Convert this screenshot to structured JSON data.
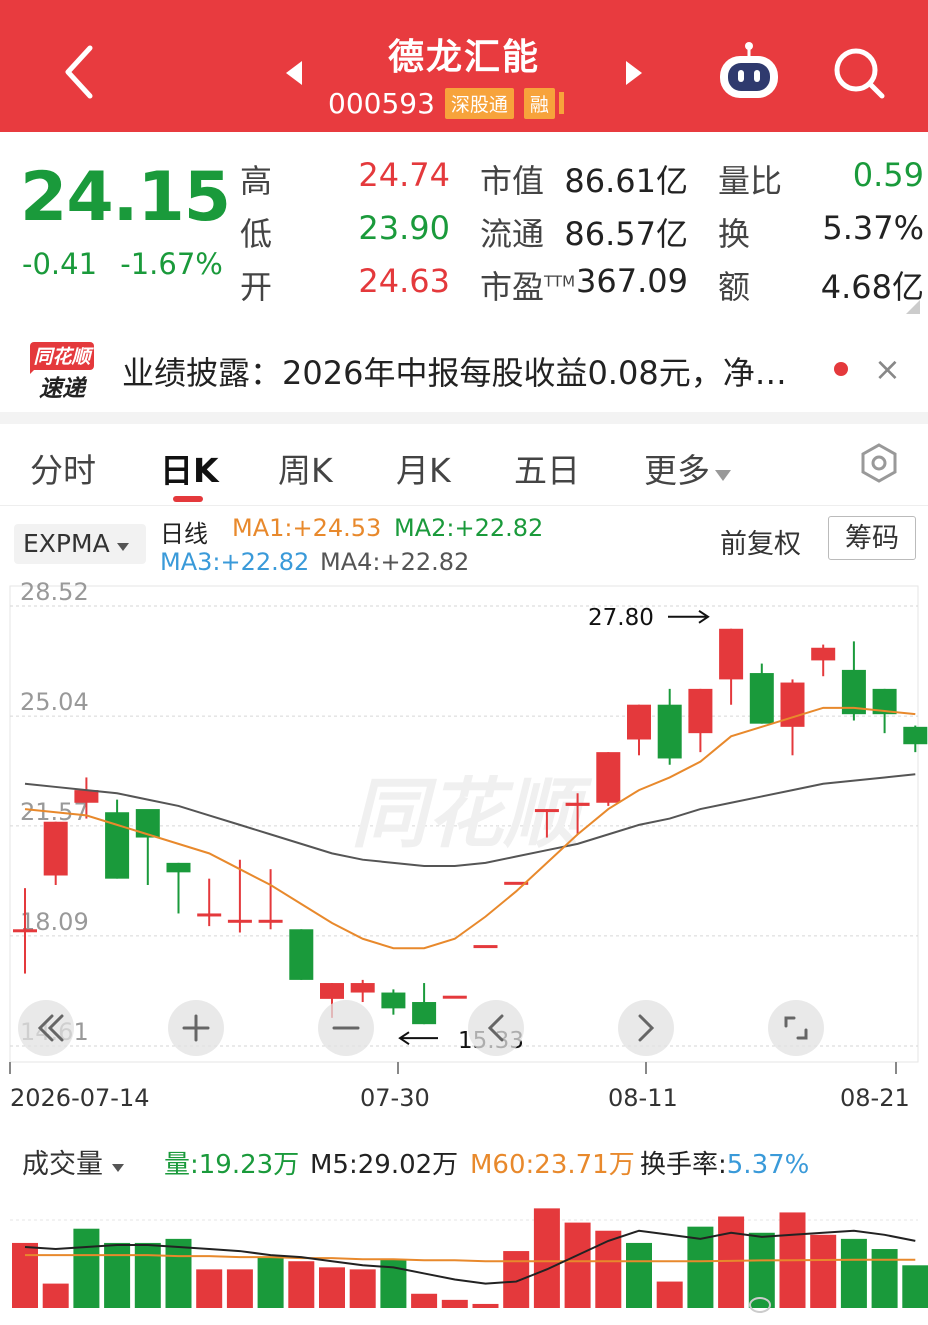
{
  "header": {
    "name": "德龙汇能",
    "code": "000593",
    "tags": [
      "深股通",
      "融"
    ],
    "icons": [
      "back-arrow-icon",
      "prev-triangle-icon",
      "next-triangle-icon",
      "robot-assistant-icon",
      "search-icon"
    ]
  },
  "quote": {
    "price": "24.15",
    "change": "-0.41",
    "change_pct": "-1.67%",
    "high_label": "高",
    "high": "24.74",
    "low_label": "低",
    "low": "23.90",
    "open_label": "开",
    "open": "24.63",
    "mktcap_label": "市值",
    "mktcap": "86.61亿",
    "float_label": "流通",
    "float": "86.57亿",
    "pe_label": "市盈",
    "pe_sup": "TTM",
    "pe": "367.09",
    "volratio_label": "量比",
    "volratio": "0.59",
    "turnover_label": "换",
    "turnover": "5.37%",
    "amount_label": "额",
    "amount": "4.68亿"
  },
  "news": {
    "logo_line1": "同花顺",
    "logo_line2": "速递",
    "text": "业绩披露：2026年中报每股收益0.08元，净…",
    "close": "×"
  },
  "tabs": [
    {
      "label": "分时"
    },
    {
      "label": "日K",
      "active": true
    },
    {
      "label": "周K"
    },
    {
      "label": "月K"
    },
    {
      "label": "五日"
    },
    {
      "label": "更多"
    }
  ],
  "indicators": {
    "select": "EXPMA",
    "period": "日线",
    "ma1": "MA1:+24.53",
    "ma2": "MA2:+22.82",
    "ma3": "MA3:+22.82",
    "ma4": "MA4:+22.82",
    "fq": "前复权",
    "chips": "筹码"
  },
  "colors": {
    "up": "#e4393c",
    "down": "#1a9a3b",
    "header": "#e83b3f",
    "ma_orange": "#e8892c",
    "ma_gray": "#555555",
    "ma_blue": "#3a9ad9"
  },
  "chart_data": [
    {
      "type": "candlestick",
      "y_ticks": [
        "28.52",
        "25.04",
        "21.57",
        "18.09",
        "14.61"
      ],
      "ylim": [
        14.61,
        28.52
      ],
      "x_labels": [
        "2026-07-14",
        "07-30",
        "08-11",
        "08-21"
      ],
      "annotations": {
        "max": "27.80",
        "min": "15.33"
      },
      "candles": [
        {
          "o": 18.3,
          "c": 18.3,
          "h": 19.6,
          "l": 16.9
        },
        {
          "o": 20.0,
          "c": 21.7,
          "h": 21.7,
          "l": 19.7
        },
        {
          "o": 22.3,
          "c": 22.7,
          "h": 23.1,
          "l": 21.8
        },
        {
          "o": 22.0,
          "c": 19.9,
          "h": 22.4,
          "l": 19.9
        },
        {
          "o": 22.1,
          "c": 21.2,
          "h": 21.9,
          "l": 19.7
        },
        {
          "o": 20.4,
          "c": 20.1,
          "h": 20.4,
          "l": 18.8
        },
        {
          "o": 18.8,
          "c": 18.8,
          "h": 19.9,
          "l": 18.4
        },
        {
          "o": 18.6,
          "c": 18.6,
          "h": 20.5,
          "l": 18.2
        },
        {
          "o": 18.6,
          "c": 18.6,
          "h": 20.2,
          "l": 18.3
        },
        {
          "o": 18.3,
          "c": 16.7,
          "h": 18.3,
          "l": 16.7
        },
        {
          "o": 16.1,
          "c": 16.6,
          "h": 16.6,
          "l": 15.5
        },
        {
          "o": 16.3,
          "c": 16.6,
          "h": 16.7,
          "l": 16.0
        },
        {
          "o": 16.3,
          "c": 15.8,
          "h": 16.4,
          "l": 15.6
        },
        {
          "o": 16.0,
          "c": 15.3,
          "h": 16.6,
          "l": 15.3
        },
        {
          "o": 16.2,
          "c": 16.2,
          "h": 16.2,
          "l": 16.2
        },
        {
          "o": 17.8,
          "c": 17.8,
          "h": 17.8,
          "l": 17.8
        },
        {
          "o": 19.8,
          "c": 19.8,
          "h": 19.8,
          "l": 19.8
        },
        {
          "o": 22.1,
          "c": 22.1,
          "h": 22.1,
          "l": 21.2
        },
        {
          "o": 22.2,
          "c": 22.3,
          "h": 22.6,
          "l": 21.3
        },
        {
          "o": 22.3,
          "c": 23.9,
          "h": 23.9,
          "l": 22.2
        },
        {
          "o": 24.3,
          "c": 25.4,
          "h": 25.4,
          "l": 23.8
        },
        {
          "o": 25.4,
          "c": 23.7,
          "h": 25.9,
          "l": 23.5
        },
        {
          "o": 24.5,
          "c": 25.9,
          "h": 25.9,
          "l": 23.9
        },
        {
          "o": 26.2,
          "c": 27.8,
          "h": 27.8,
          "l": 25.4
        },
        {
          "o": 26.4,
          "c": 24.8,
          "h": 26.7,
          "l": 24.8
        },
        {
          "o": 24.7,
          "c": 26.1,
          "h": 26.2,
          "l": 23.8
        },
        {
          "o": 26.8,
          "c": 27.2,
          "h": 27.3,
          "l": 26.3
        },
        {
          "o": 26.5,
          "c": 25.1,
          "h": 27.4,
          "l": 24.9
        },
        {
          "o": 25.9,
          "c": 25.1,
          "h": 25.9,
          "l": 24.5
        },
        {
          "o": 24.7,
          "c": 24.15,
          "h": 24.74,
          "l": 23.9
        }
      ],
      "ma_orange": [
        22.1,
        22.0,
        21.9,
        21.6,
        21.3,
        21.0,
        20.7,
        20.2,
        19.7,
        19.1,
        18.5,
        18.0,
        17.7,
        17.7,
        18.0,
        18.7,
        19.5,
        20.4,
        21.3,
        22.1,
        22.7,
        23.1,
        23.6,
        24.4,
        24.7,
        25.0,
        25.3,
        25.3,
        25.2,
        25.1
      ],
      "ma_gray": [
        22.9,
        22.8,
        22.7,
        22.6,
        22.4,
        22.2,
        21.9,
        21.6,
        21.3,
        21.0,
        20.7,
        20.5,
        20.4,
        20.3,
        20.3,
        20.4,
        20.6,
        20.8,
        21.0,
        21.3,
        21.6,
        21.8,
        22.1,
        22.3,
        22.5,
        22.7,
        22.9,
        23.0,
        23.1,
        23.2
      ]
    },
    {
      "type": "bar",
      "title": "成交量",
      "ylim": [
        0,
        60
      ],
      "values": [
        32,
        12,
        39,
        32,
        32,
        34,
        19,
        19,
        25,
        23,
        20,
        19,
        24,
        7,
        4,
        2,
        28,
        49,
        42,
        38,
        32,
        13,
        40,
        45,
        37,
        47,
        36,
        34,
        29,
        21
      ],
      "up": [
        true,
        true,
        false,
        false,
        false,
        false,
        true,
        true,
        false,
        true,
        true,
        true,
        false,
        true,
        true,
        true,
        true,
        true,
        true,
        true,
        false,
        true,
        false,
        true,
        false,
        true,
        true,
        false,
        false,
        false
      ],
      "ma5": [
        30,
        29,
        30,
        31,
        31,
        30,
        29,
        28,
        26,
        25,
        23,
        21,
        20,
        17,
        14,
        12,
        13,
        19,
        26,
        33,
        38,
        36,
        34,
        37,
        35,
        36,
        37,
        38,
        36,
        33
      ],
      "ma60": [
        26,
        26,
        26,
        26,
        26,
        25.5,
        25.5,
        25,
        25,
        24.5,
        24.5,
        24,
        24,
        23.5,
        23.5,
        23,
        23,
        23,
        23,
        23,
        23,
        23,
        23,
        23.2,
        23.4,
        23.5,
        23.6,
        23.7,
        23.7,
        23.71
      ]
    }
  ],
  "volume": {
    "select": "成交量",
    "vol": "量:19.23万",
    "m5": "M5:29.02万",
    "m60": "M60:23.71万",
    "turnover_label": "换手率:",
    "turnover": "5.37%"
  }
}
